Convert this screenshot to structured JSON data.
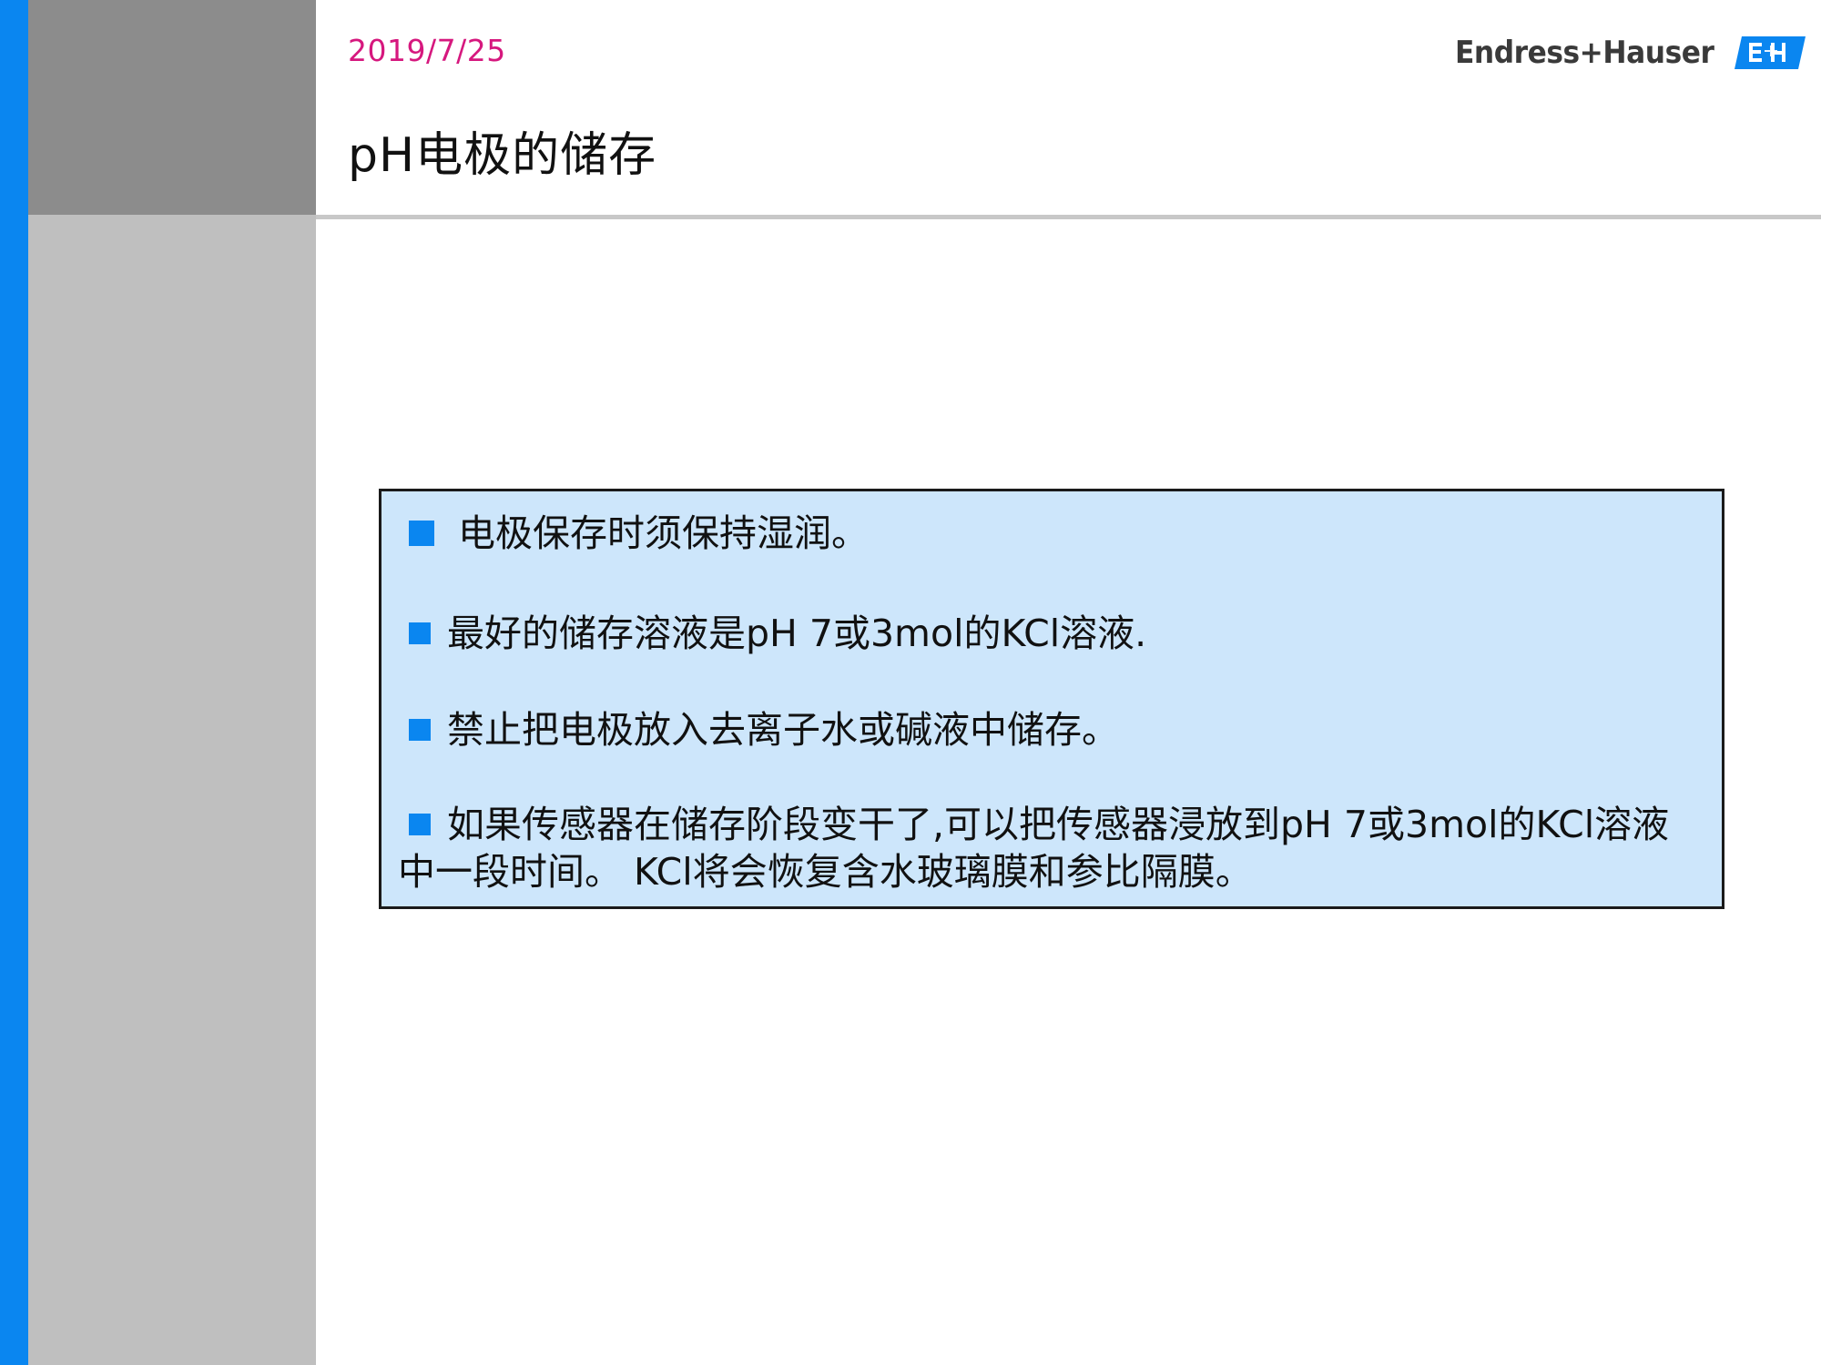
{
  "header": {
    "date": "2019/7/25",
    "title": "pH电极的储存",
    "logo_text": "Endress+Hauser"
  },
  "colors": {
    "accent_blue": "#0a86f0",
    "date_magenta": "#d6187e",
    "box_fill": "#cde6fb",
    "sidebar_gray": "#bfbfbf",
    "header_gray": "#8c8c8c"
  },
  "content": {
    "bullets": [
      {
        "text": "电极保存时须保持湿润。"
      },
      {
        "text": "最好的储存溶液是pH 7或3mol的KCl溶液."
      },
      {
        "text": "禁止把电极放入去离子水或碱液中储存。"
      },
      {
        "text": "如果传感器在储存阶段变干了,可以把传感器浸放到pH 7或3mol的KCl溶液中一段时间。 KCl将会恢复含水玻璃膜和参比隔膜。"
      }
    ],
    "bullet_icon": "blue-square-bullet-icon"
  }
}
